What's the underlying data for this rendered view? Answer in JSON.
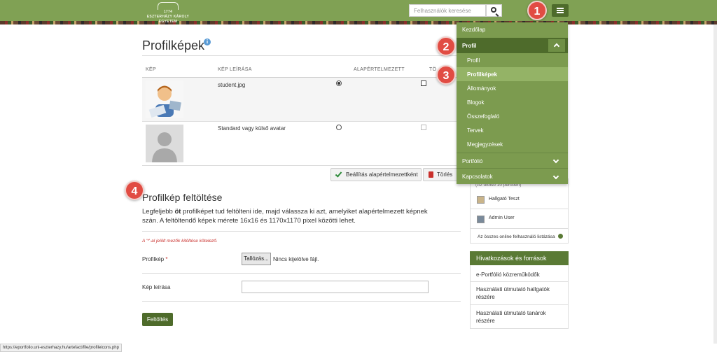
{
  "header": {
    "logo_top": "1774",
    "logo_name": "ESZTERHÁZY KÁROLY EGYETEM",
    "search_placeholder": "Felhasználók keresése"
  },
  "badges": [
    "1",
    "2",
    "3",
    "4"
  ],
  "main": {
    "title": "Profilképek",
    "table": {
      "headers": [
        "KÉP",
        "KÉP LEÍRÁSA",
        "ALAPÉRTELMEZETT",
        "TÖ"
      ],
      "rows": [
        {
          "description": "student.jpg",
          "default": true
        },
        {
          "description": "Standard vagy külső avatar",
          "default": false
        }
      ]
    },
    "set_default_label": "Beállítás alapértelmezettként",
    "delete_label": "Törlés",
    "upload_title": "Profilkép feltöltése",
    "upload_desc_pre": "Legfeljebb ",
    "upload_desc_bold": "öt",
    "upload_desc_post": " profilképet tud feltölteni ide, majd válassza ki azt, amelyiket alapértelmezett képnek szán. A feltöltendő képek mérete 16x16 és 1170x1170 pixel közötti lehet.",
    "required_note": "A '*'-al jelölt mezők kitöltése kötelező.",
    "profile_label": "Profilkép",
    "required_star": "*",
    "browse_label": "Tallózás...",
    "no_file": "Nincs kijelölve fájl.",
    "caption_label": "Kép leírása",
    "submit_label": "Feltöltés"
  },
  "nav": {
    "home": "Kezdőlap",
    "profile_section": "Profil",
    "sub_items": [
      "Profil",
      "Profilképek",
      "Állományok",
      "Blogok",
      "Összefoglaló",
      "Tervek",
      "Megjegyzések"
    ],
    "portfolio": "Portfólió",
    "contacts": "Kapcsolatok"
  },
  "sidebar": {
    "online_note": "(Az utolsó 10 percben)",
    "users": [
      "Hallgató Teszt",
      "Admin User"
    ],
    "all_online": "Az összes online felhasználó listázása",
    "links_title": "Hivatkozások és források",
    "links": [
      "e-Portfólió közreműködők",
      "Használati útmutató hallgatók részére",
      "Használati útmutató tanárok részére"
    ]
  },
  "statusbar": "https://eportfolio.uni-eszterhazy.hu/artefact/file/profileicons.php",
  "colors": {
    "header": "#80a154",
    "dark_green": "#4e6b2b",
    "badge": "#e14c43",
    "active_item": "#5a7a35"
  }
}
